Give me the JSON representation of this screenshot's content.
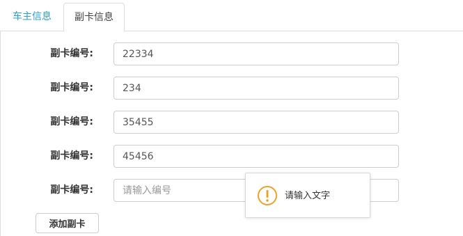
{
  "tabs": [
    {
      "label": "车主信息",
      "active": false
    },
    {
      "label": "副卡信息",
      "active": true
    }
  ],
  "form": {
    "rows": [
      {
        "label": "副卡编号:",
        "value": "22334",
        "placeholder": ""
      },
      {
        "label": "副卡编号:",
        "value": "234",
        "placeholder": ""
      },
      {
        "label": "副卡编号:",
        "value": "35455",
        "placeholder": ""
      },
      {
        "label": "副卡编号:",
        "value": "45456",
        "placeholder": ""
      },
      {
        "label": "副卡编号:",
        "value": "",
        "placeholder": "请输入编号"
      }
    ],
    "add_button_label": "添加副卡"
  },
  "tooltip": {
    "message": "请输入文字",
    "icon": "warning-icon"
  },
  "colors": {
    "active_tab_text": "#444444",
    "inactive_tab_text": "#2a9fd6",
    "warning": "#f0a02a"
  }
}
